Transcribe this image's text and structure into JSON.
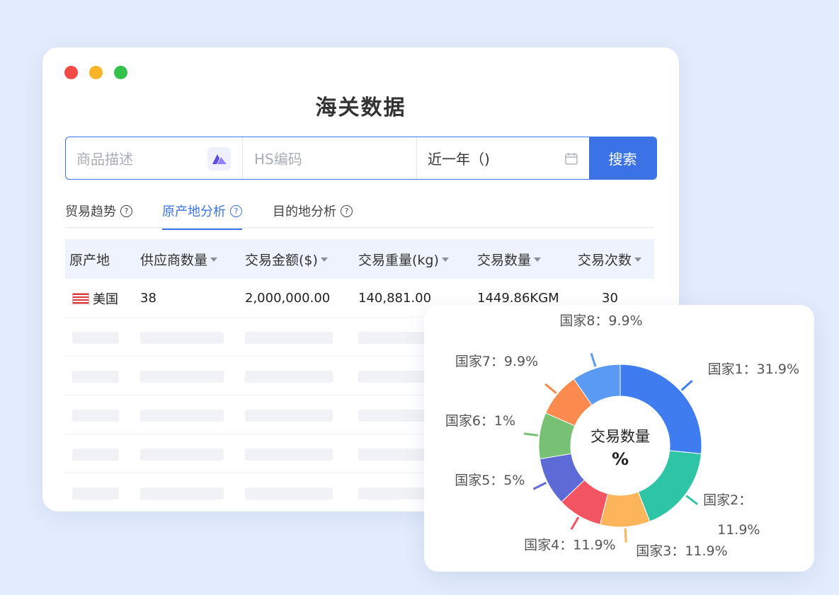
{
  "window": {
    "title": "海关数据",
    "controls": [
      "#f24a45",
      "#f8b426",
      "#33c14a"
    ]
  },
  "search": {
    "desc_placeholder": "商品描述",
    "hs_placeholder": "HS编码",
    "date_value": "近一年（)",
    "search_button": "搜索"
  },
  "tabs": [
    {
      "label": "贸易趋势",
      "active": false
    },
    {
      "label": "原产地分析",
      "active": true
    },
    {
      "label": "目的地分析",
      "active": false
    }
  ],
  "table": {
    "headers": [
      "原产地",
      "供应商数量",
      "交易金额($)",
      "交易重量(kg)",
      "交易数量",
      "交易次数"
    ],
    "rows": [
      {
        "country": "美国",
        "suppliers": "38",
        "amount": "2,000,000.00",
        "weight": "140,881.00",
        "quantity": "1449.86KGM",
        "count": "30"
      }
    ]
  },
  "colors": {
    "accent": "#3b73e6"
  },
  "chart_data": {
    "type": "pie",
    "center_title": "交易数量",
    "center_unit": "%",
    "slices": [
      {
        "label": "国家1：31.9%",
        "name": "国家1",
        "value": 31.9,
        "color": "#3f7cf0"
      },
      {
        "label": "国家2：11.9%",
        "label_line1": "国家2：",
        "label_line2": "11.9%",
        "name": "国家2",
        "value": 21.0,
        "color": "#2ec4a6"
      },
      {
        "label": "国家3：11.9%",
        "name": "国家3",
        "value": 11.9,
        "color": "#fcb55a"
      },
      {
        "label": "国家4：11.9%",
        "name": "国家4",
        "value": 10.6,
        "color": "#f25561"
      },
      {
        "label": "国家5：5%",
        "name": "国家5",
        "value": 11.5,
        "color": "#5e6ad6"
      },
      {
        "label": "国家6：1%",
        "name": "国家6",
        "value": 11.0,
        "color": "#76c173"
      },
      {
        "label": "国家7：9.9%",
        "name": "国家7",
        "value": 10.5,
        "color": "#fa8a4d"
      },
      {
        "label": "国家8：9.9%",
        "name": "国家8",
        "value": 11.6,
        "color": "#5b9af2"
      }
    ]
  }
}
